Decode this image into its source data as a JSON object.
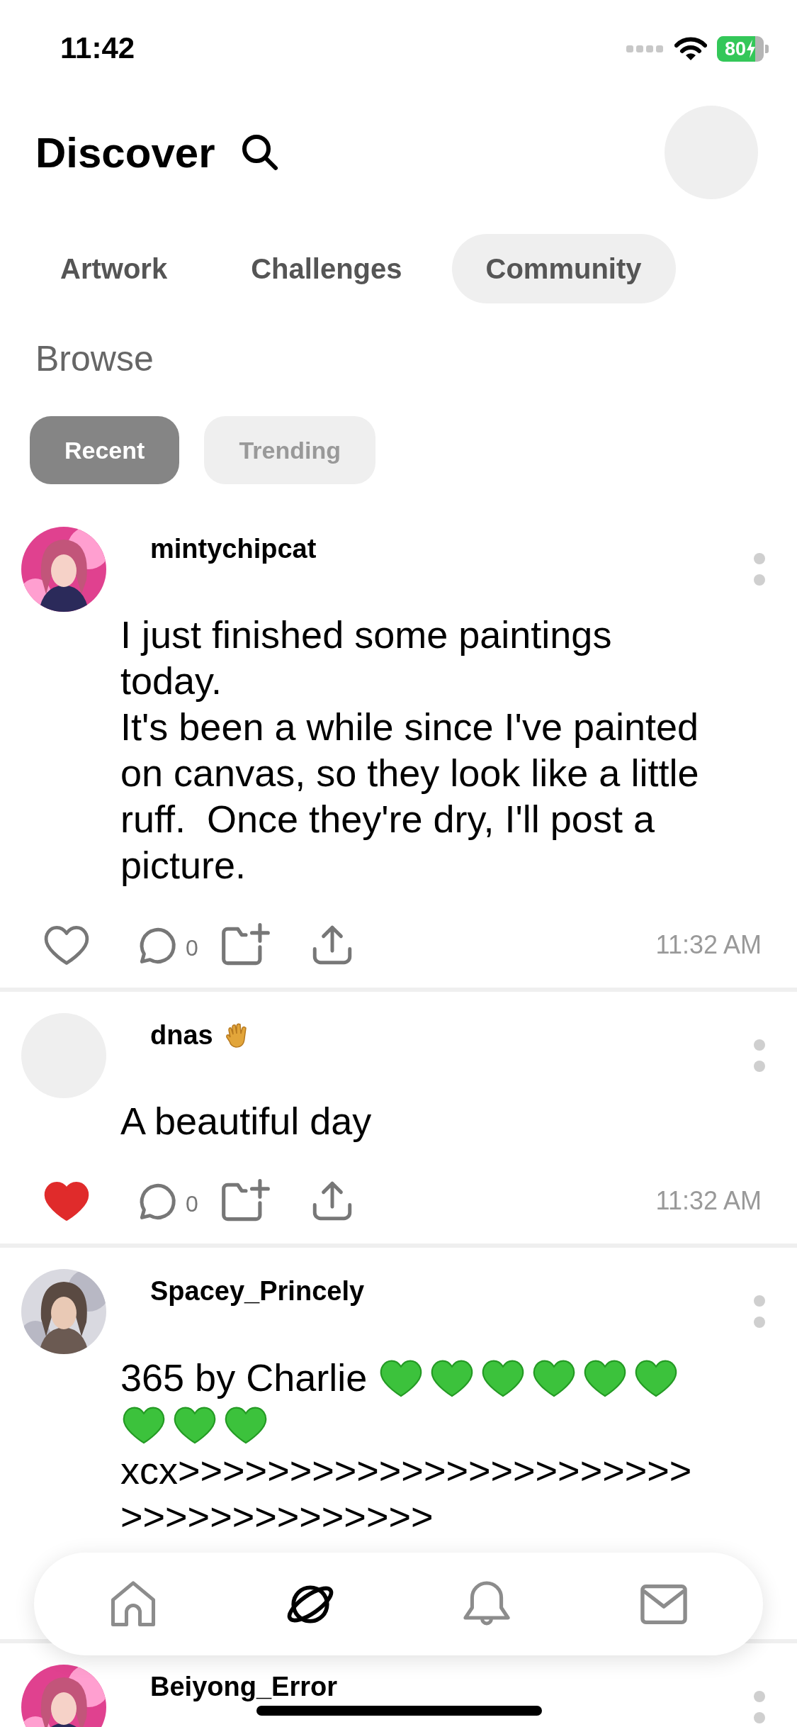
{
  "status_bar": {
    "time": "11:42",
    "battery": "80"
  },
  "header": {
    "title": "Discover"
  },
  "tabs": [
    {
      "label": "Artwork",
      "selected": false
    },
    {
      "label": "Challenges",
      "selected": false
    },
    {
      "label": "Community",
      "selected": true
    }
  ],
  "section_title": "Browse",
  "filters": [
    {
      "label": "Recent",
      "selected": true
    },
    {
      "label": "Trending",
      "selected": false
    }
  ],
  "posts": [
    {
      "user": "mintychipcat",
      "avatar": {
        "kind": "picture"
      },
      "body": [
        {
          "kind": "text",
          "text": "I just finished some paintings today.\nIt's been a while since I've painted on canvas, so they look like a little ruff.  Once they're dry, I'll post a picture."
        }
      ],
      "actions": {
        "liked": false,
        "comments": "0",
        "time": "11:32 AM"
      }
    },
    {
      "user": "dnas",
      "badge": {
        "kind": "wave"
      },
      "body": [
        {
          "kind": "text",
          "text": "A beautiful day"
        }
      ],
      "actions": {
        "liked": true,
        "comments": "0",
        "time": "11:32 AM"
      }
    },
    {
      "user": "Spacey_Princely",
      "avatar": {
        "kind": "picture"
      },
      "body": [
        {
          "kind": "text",
          "text": "365 by Charlie "
        },
        {
          "kind": "green_heart"
        },
        {
          "kind": "green_heart"
        },
        {
          "kind": "green_heart"
        },
        {
          "kind": "green_heart"
        },
        {
          "kind": "green_heart"
        },
        {
          "kind": "green_heart"
        },
        {
          "kind": "green_heart"
        },
        {
          "kind": "green_heart"
        },
        {
          "kind": "green_heart"
        },
        {
          "kind": "break"
        },
        {
          "kind": "text",
          "text": "xcx>>>>>>>>>>>>>>>>>>>>>>>\n>>>>>>>>>>>>>>"
        }
      ]
    },
    {
      "user": "Beiyong_Error",
      "avatar": {
        "kind": "picture"
      }
    }
  ],
  "nav": [
    {
      "kind": "home",
      "selected": false
    },
    {
      "kind": "planet",
      "selected": true
    },
    {
      "kind": "bell",
      "selected": false
    },
    {
      "kind": "mail",
      "selected": false
    }
  ]
}
